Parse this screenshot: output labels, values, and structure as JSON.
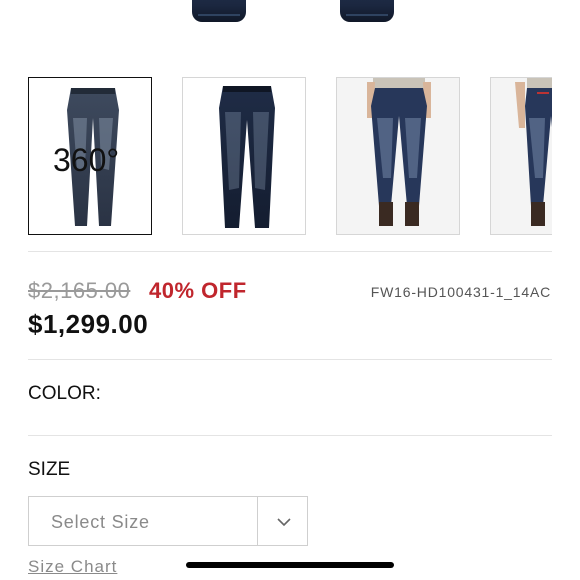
{
  "gallery": {
    "thumbnails": [
      {
        "label": "360°",
        "selected": true,
        "icon": "jeans-front-360"
      },
      {
        "label": "",
        "selected": false,
        "icon": "jeans-front"
      },
      {
        "label": "",
        "selected": false,
        "icon": "model-front"
      },
      {
        "label": "",
        "selected": false,
        "icon": "model-side"
      }
    ]
  },
  "pricing": {
    "original_price": "$2,165.00",
    "discount": "40% OFF",
    "current_price": "$1,299.00",
    "sku": "FW16-HD100431-1_14AC",
    "discount_color": "#c0262d"
  },
  "color": {
    "label": "COLOR:"
  },
  "size": {
    "label": "SIZE",
    "select_placeholder": "Select Size",
    "size_chart_link": "Size Chart"
  }
}
